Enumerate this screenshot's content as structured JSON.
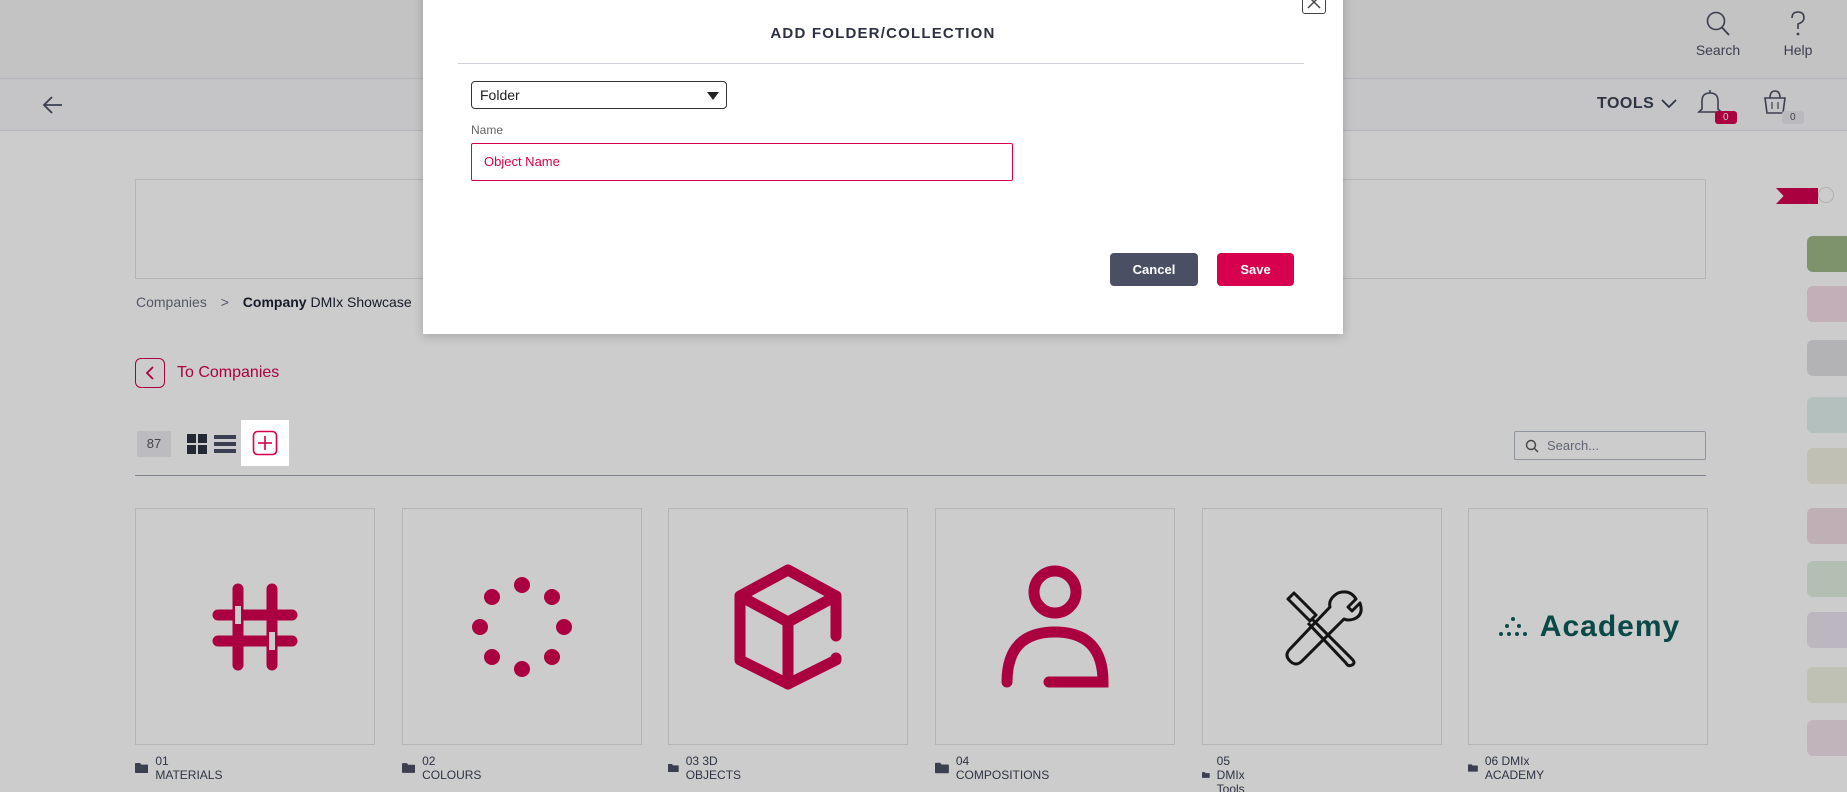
{
  "header": {
    "search_label": "Search",
    "help_label": "Help",
    "tools_label": "TOOLS",
    "notifications_count": "0",
    "cart_count": "0"
  },
  "breadcrumb": {
    "root": "Companies",
    "separator": ">",
    "current_bold": "Company",
    "current_rest": " DMIx Showcase"
  },
  "back_link": {
    "label": "To Companies"
  },
  "toolbar": {
    "count": "87",
    "search_placeholder": "Search..."
  },
  "cards": [
    {
      "label": "01 MATERIALS",
      "icon": "hashtag-icon"
    },
    {
      "label": "02 COLOURS",
      "icon": "dots-circle-icon"
    },
    {
      "label": "03 3D OBJECTS",
      "icon": "cube-icon"
    },
    {
      "label": "04 COMPOSITIONS",
      "icon": "person-icon"
    },
    {
      "label": "05 DMIx Tools",
      "icon": "tools-icon"
    },
    {
      "label": "06 DMIx ACADEMY",
      "icon": "academy-logo"
    }
  ],
  "academy_logo_text": "Academy",
  "modal": {
    "title": "ADD FOLDER/COLLECTION",
    "type_selected": "Folder",
    "name_label": "Name",
    "name_placeholder": "Object Name",
    "cancel_label": "Cancel",
    "save_label": "Save"
  },
  "colors": {
    "accent": "#d6004f",
    "dark": "#4a4f63",
    "teal": "#0e5a5a"
  }
}
